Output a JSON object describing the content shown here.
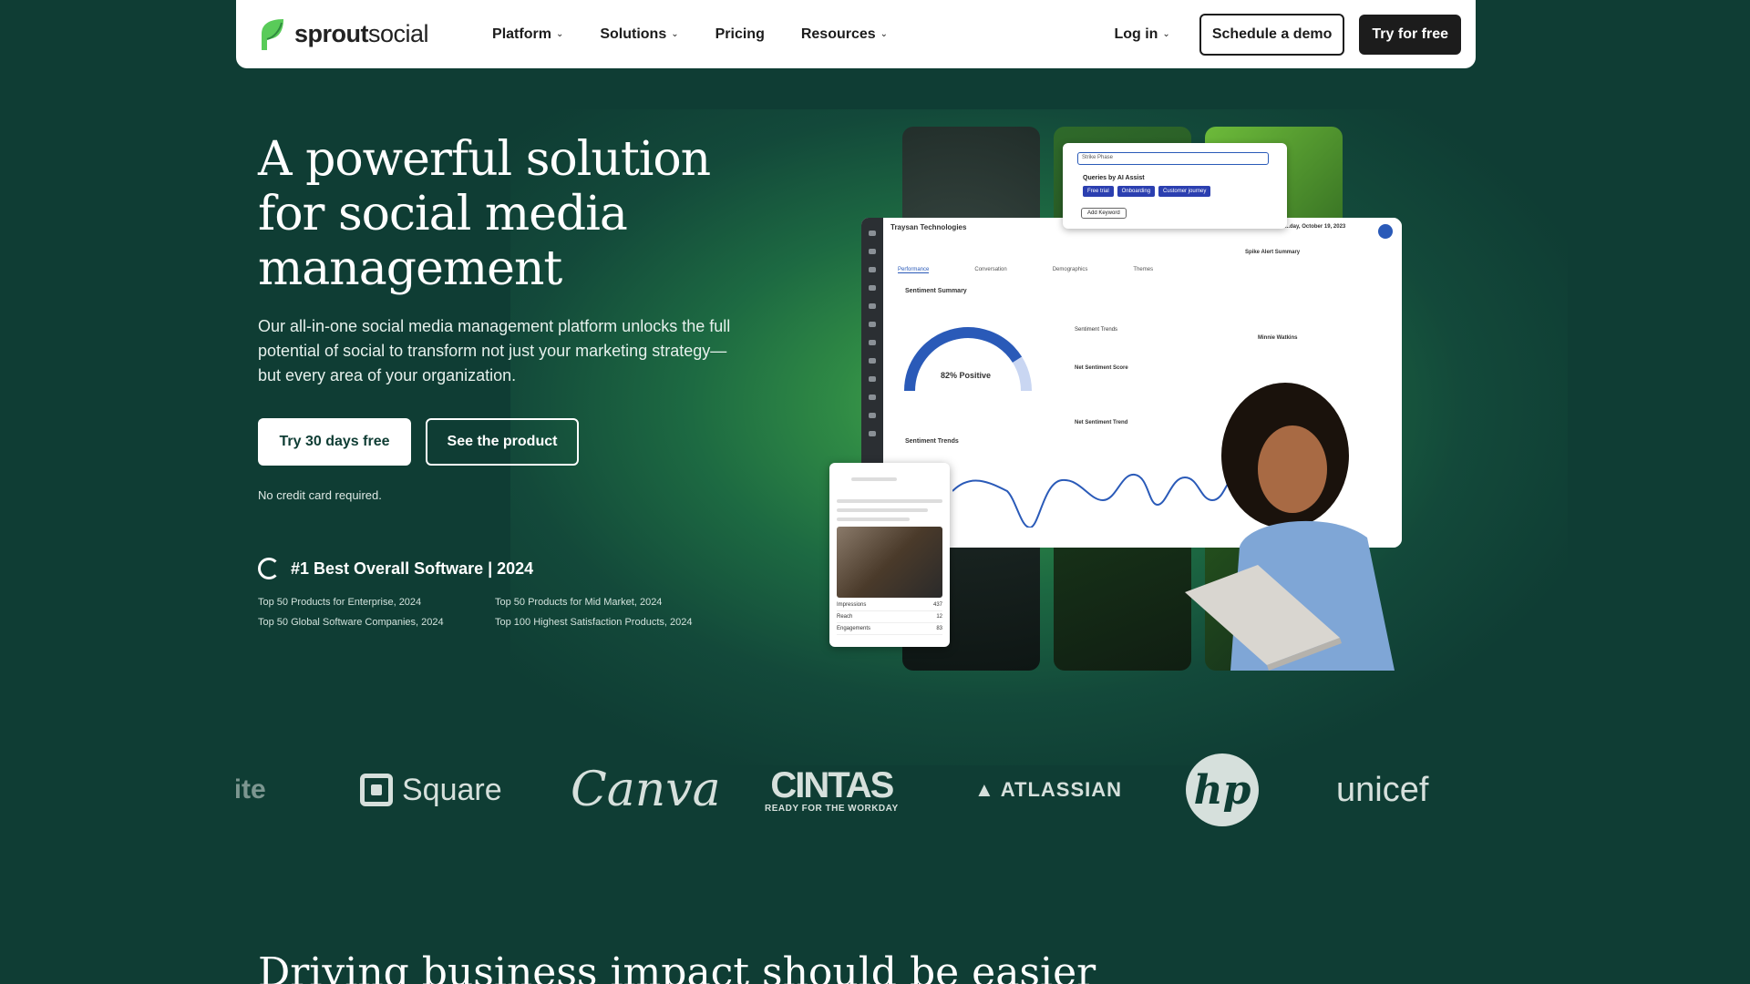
{
  "nav": {
    "logo_bold": "sprout",
    "logo_rest": "social",
    "links": [
      {
        "label": "Platform",
        "dropdown": true
      },
      {
        "label": "Solutions",
        "dropdown": true
      },
      {
        "label": "Pricing",
        "dropdown": false
      },
      {
        "label": "Resources",
        "dropdown": true
      }
    ],
    "login": "Log in",
    "demo": "Schedule a demo",
    "try_free": "Try for free"
  },
  "hero": {
    "title": "A powerful solution for social media management",
    "subtitle": "Our all-in-one social media management platform unlocks the full potential of social to transform not just your marketing strategy—but every area of your organization.",
    "cta_primary": "Try 30 days free",
    "cta_secondary": "See the product",
    "note": "No credit card required.",
    "award_title": "#1 Best Overall Software | 2024",
    "awards": [
      "Top 50 Products for Enterprise, 2024",
      "Top 50 Products for Mid Market, 2024",
      "Top 50 Global Software Companies, 2024",
      "Top 100 Highest Satisfaction Products, 2024"
    ]
  },
  "mockup": {
    "company": "Traysan Technologies",
    "tabs": [
      "Performance",
      "Conversation",
      "Demographics",
      "Themes"
    ],
    "sentiment_summary": "Sentiment Summary",
    "gauge_label": "82% Positive",
    "gauge_value": 0.82,
    "sentiment_trends_box": "Sentiment Trends",
    "net_score": "Net Sentiment Score",
    "net_trend": "Net Sentiment Trend",
    "trends_title": "Sentiment Trends",
    "popup_input": "Strike Phase",
    "popup_title": "Queries by AI Assist",
    "chips": [
      "Free trial",
      "Onboarding",
      "Customer journey"
    ],
    "add_keyword": "Add Keyword",
    "panel_date": "...day, October 19, 2023",
    "panel_title": "Spike Alert Summary",
    "panel_name": "Minnie Watkins",
    "card_stats": [
      {
        "label": "Impressions",
        "value": "437"
      },
      {
        "label": "Reach",
        "value": "12"
      },
      {
        "label": "Engagements",
        "value": "83"
      }
    ]
  },
  "logos": {
    "partial": "rite",
    "square": "Square",
    "canva": "Canva",
    "cintas_big": "CINTAS",
    "cintas_small": "READY FOR THE WORKDAY",
    "atlassian": "ATLASSIAN",
    "hp": "hp",
    "unicef": "unicef"
  },
  "next_section_title": "Driving business impact should be easier",
  "colors": {
    "background": "#0f3d34",
    "accent_green": "#4fb04c",
    "chip_blue": "#2b3fb0"
  }
}
